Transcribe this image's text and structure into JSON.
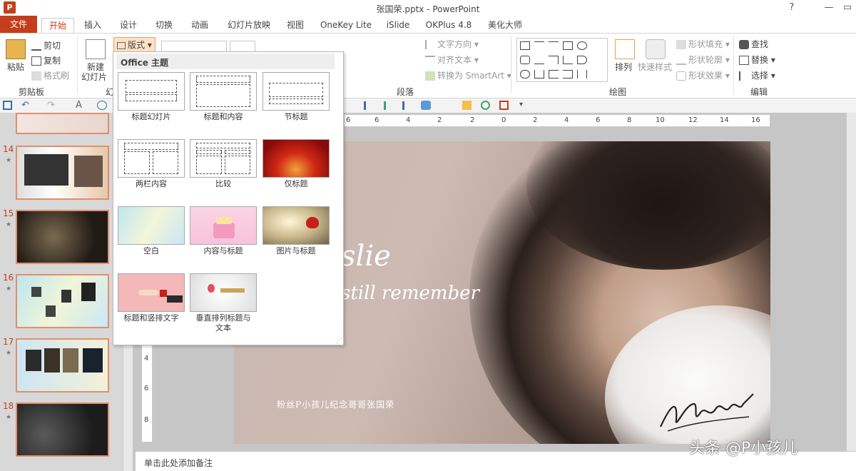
{
  "window": {
    "title": "张国荣.pptx - PowerPoint",
    "logo": "P",
    "help": "?",
    "minimize": "—",
    "restore": "▭"
  },
  "tabs": [
    "文件",
    "开始",
    "插入",
    "设计",
    "切换",
    "动画",
    "幻灯片放映",
    "视图",
    "OneKey Lite",
    "iSlide",
    "OKPlus 4.8",
    "美化大师"
  ],
  "ribbon": {
    "clipboard": {
      "paste": "粘贴",
      "cut": "剪切",
      "copy": "复制",
      "format_painter": "格式刷",
      "label": "剪贴板"
    },
    "slides": {
      "new_slide_line1": "新建",
      "new_slide_line2": "幻灯片",
      "layout": "版式",
      "label_partial": "幻"
    },
    "paragraph": {
      "text_direction": "文字方向",
      "align_text": "对齐文本",
      "convert_smartart": "转换为 SmartArt",
      "label": "段落"
    },
    "drawing": {
      "arrange": "排列",
      "quick_styles": "快速样式",
      "shape_fill": "形状填充",
      "shape_outline": "形状轮廓",
      "shape_effects": "形状效果",
      "label": "绘图"
    },
    "editing": {
      "find": "查找",
      "replace": "替换",
      "select": "选择",
      "label": "编辑"
    }
  },
  "layout_menu": {
    "header": "Office 主题",
    "items": [
      "标题幻灯片",
      "标题和内容",
      "节标题",
      "两栏内容",
      "比较",
      "仅标题",
      "空白",
      "内容与标题",
      "图片与标题",
      "标题和竖排文字",
      "垂直排列标题与",
      "文本"
    ]
  },
  "slides": {
    "numbers": [
      "14",
      "15",
      "16",
      "17",
      "18"
    ],
    "star": "★"
  },
  "ruler": {
    "h_ticks": [
      "6",
      "4",
      "2",
      "0",
      "2",
      "4",
      "6",
      "8",
      "10",
      "12",
      "14",
      "16"
    ],
    "v_ticks": [
      "4",
      "6",
      "8"
    ]
  },
  "slide": {
    "script_line1": "slie",
    "script_line2": "still remember",
    "caption": "粉丝P小孩儿纪念哥哥张国荣"
  },
  "notes": {
    "placeholder": "单击此处添加备注"
  },
  "watermark": "头条 @P小孩儿",
  "colors": {
    "accent": "#c43e1c",
    "thumb_border": "#e0906c"
  }
}
